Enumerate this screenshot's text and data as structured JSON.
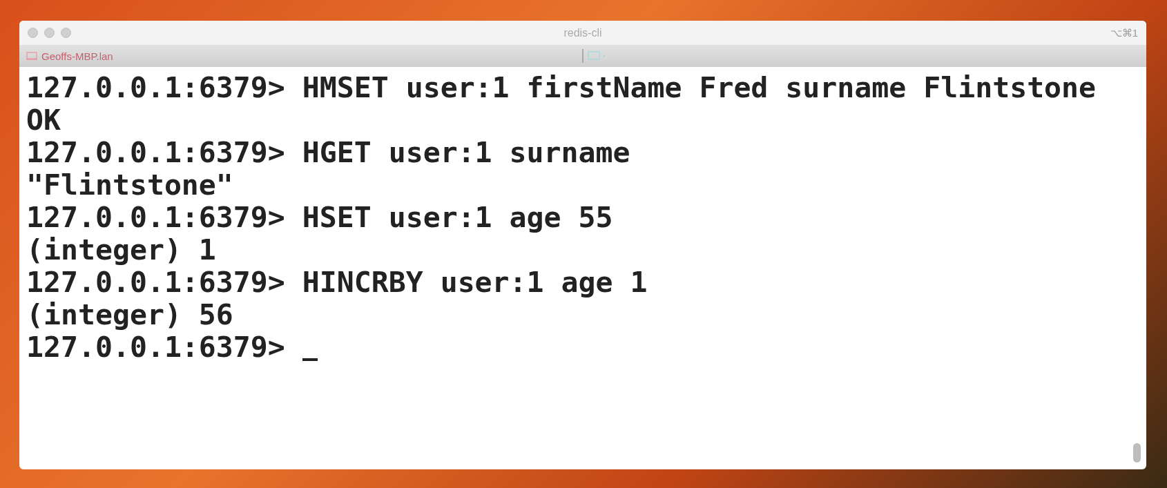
{
  "window": {
    "title": "redis-cli",
    "shortcut": "⌥⌘1"
  },
  "tab": {
    "host": "Geoffs-MBP.lan"
  },
  "terminal": {
    "lines": [
      {
        "text": "127.0.0.1:6379> HMSET user:1 firstName Fred surname Flintstone"
      },
      {
        "text": "OK"
      },
      {
        "text": "127.0.0.1:6379> HGET user:1 surname"
      },
      {
        "text": "\"Flintstone\""
      },
      {
        "text": "127.0.0.1:6379> HSET user:1 age 55"
      },
      {
        "text": "(integer) 1"
      },
      {
        "text": "127.0.0.1:6379> HINCRBY user:1 age 1"
      },
      {
        "text": "(integer) 56"
      },
      {
        "text": "127.0.0.1:6379> ",
        "cursor": true
      }
    ]
  }
}
